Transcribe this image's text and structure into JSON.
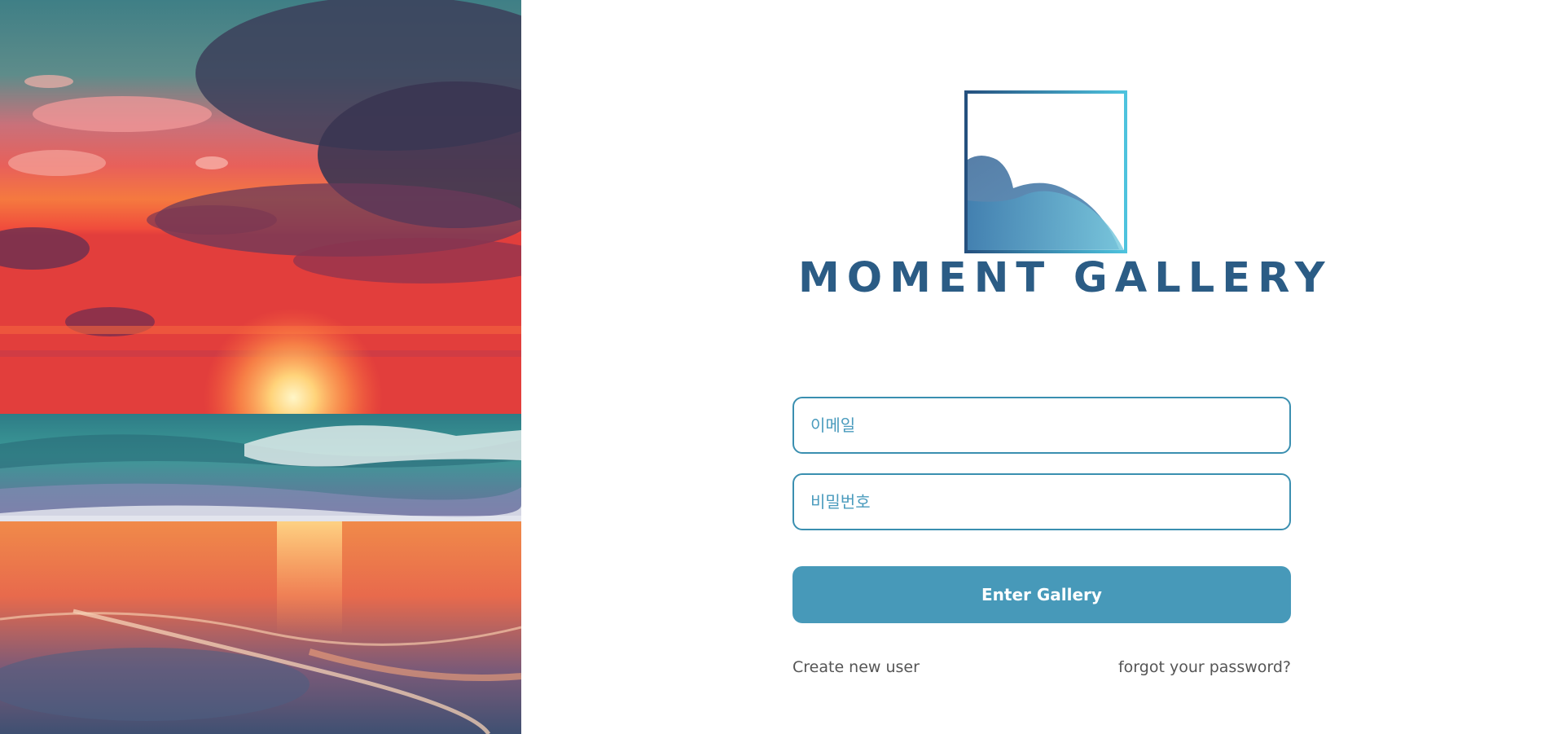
{
  "brand": {
    "name": "MOMENT GALLERY",
    "colors": {
      "primary": "#2b5c85",
      "accent": "#4799b9",
      "border": "#3a8fb0",
      "link": "#555555"
    }
  },
  "hero": {
    "image": "sunset-beach"
  },
  "form": {
    "email_placeholder": "이메일",
    "password_placeholder": "비밀번호",
    "submit_label": "Enter Gallery"
  },
  "links": {
    "create_user": "Create new user",
    "forgot_password": "forgot your password?"
  }
}
